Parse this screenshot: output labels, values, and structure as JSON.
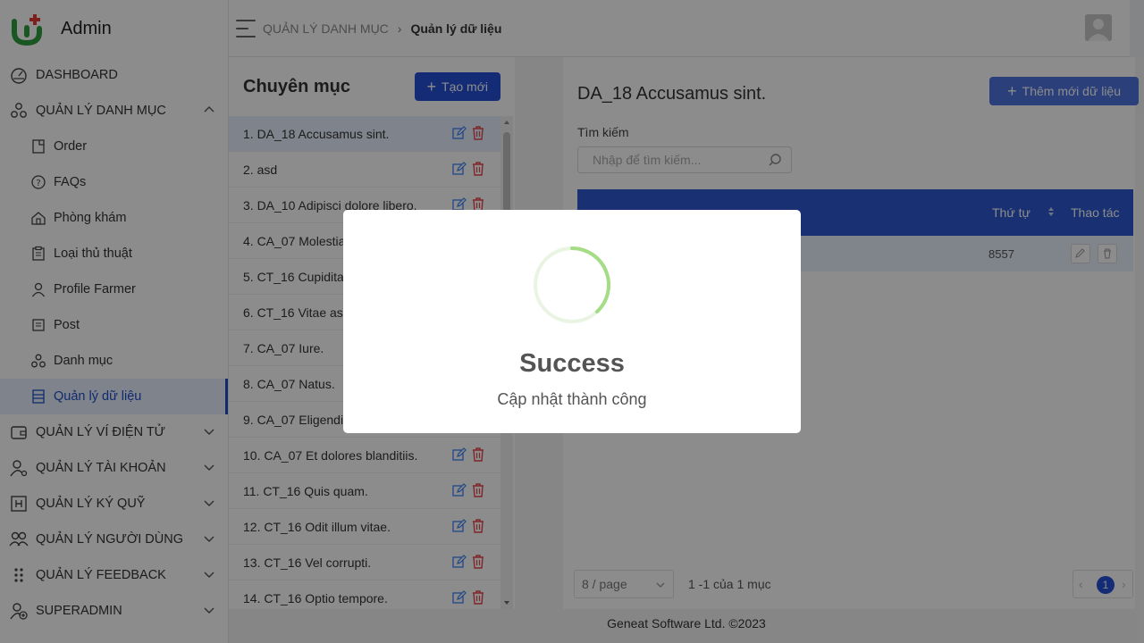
{
  "app": {
    "title": "Admin"
  },
  "sidebar": {
    "items": [
      {
        "label": "DASHBOARD",
        "icon": "dashboard-icon"
      },
      {
        "label": "QUẢN LÝ DANH MỤC",
        "icon": "category-icon",
        "expanded": true
      },
      {
        "label": "Order",
        "icon": "order-icon"
      },
      {
        "label": "FAQs",
        "icon": "question-icon"
      },
      {
        "label": "Phòng khám",
        "icon": "clinic-icon"
      },
      {
        "label": "Loại thủ thuật",
        "icon": "clipboard-icon"
      },
      {
        "label": "Profile Farmer",
        "icon": "user-icon"
      },
      {
        "label": "Post",
        "icon": "post-icon"
      },
      {
        "label": "Danh mục",
        "icon": "category-icon"
      },
      {
        "label": "Quản lý dữ liệu",
        "icon": "data-icon",
        "active": true
      },
      {
        "label": "QUẢN LÝ VÍ ĐIỆN TỬ",
        "icon": "wallet-icon"
      },
      {
        "label": "QUẢN LÝ TÀI KHOẢN",
        "icon": "account-settings-icon"
      },
      {
        "label": "QUẢN LÝ KÝ QUỸ",
        "icon": "deposit-icon"
      },
      {
        "label": "QUẢN LÝ NGƯỜI DÙNG",
        "icon": "users-icon"
      },
      {
        "label": "QUẢN LÝ FEEDBACK",
        "icon": "drag-handle-icon"
      },
      {
        "label": "SUPERADMIN",
        "icon": "user-add-icon"
      }
    ]
  },
  "header": {
    "breadcrumb": [
      "QUẢN LÝ DANH MỤC",
      "Quản lý dữ liệu"
    ]
  },
  "categories": {
    "title": "Chuyên mục",
    "create_label": "Tạo mới",
    "items": [
      "1. DA_18 Accusamus sint.",
      "2. asd",
      "3. DA_10 Adipisci dolore libero.",
      "4. CA_07 Molestia",
      "5. CT_16 Cupiditat",
      "6. CT_16 Vitae ass",
      "7. CA_07 Iure.",
      "8. CA_07 Natus.",
      "9. CA_07 Eligendi",
      "10. CA_07 Et dolores blanditiis.",
      "11. CT_16 Quis quam.",
      "12. CT_16 Odit illum vitae.",
      "13. CT_16 Vel corrupti.",
      "14. CT_16 Optio tempore."
    ]
  },
  "detail": {
    "title": "DA_18 Accusamus sint.",
    "add_label": "Thêm mới dữ liệu",
    "search_label": "Tìm kiếm",
    "search_placeholder": "Nhập để tìm kiếm...",
    "columns": {
      "order": "Thứ tự",
      "actions": "Thao tác"
    },
    "rows": [
      {
        "order": "8557"
      }
    ],
    "pager": {
      "page_size": "8 / page",
      "summary": "1 -1 của 1 mục",
      "current_page": "1"
    }
  },
  "footer": {
    "text": "Geneat Software Ltd. ©2023"
  },
  "modal": {
    "title": "Success",
    "message": "Cập nhật thành công"
  },
  "colors": {
    "primary": "#2550d8",
    "success": "#a5dc86",
    "danger": "#e5484d"
  }
}
